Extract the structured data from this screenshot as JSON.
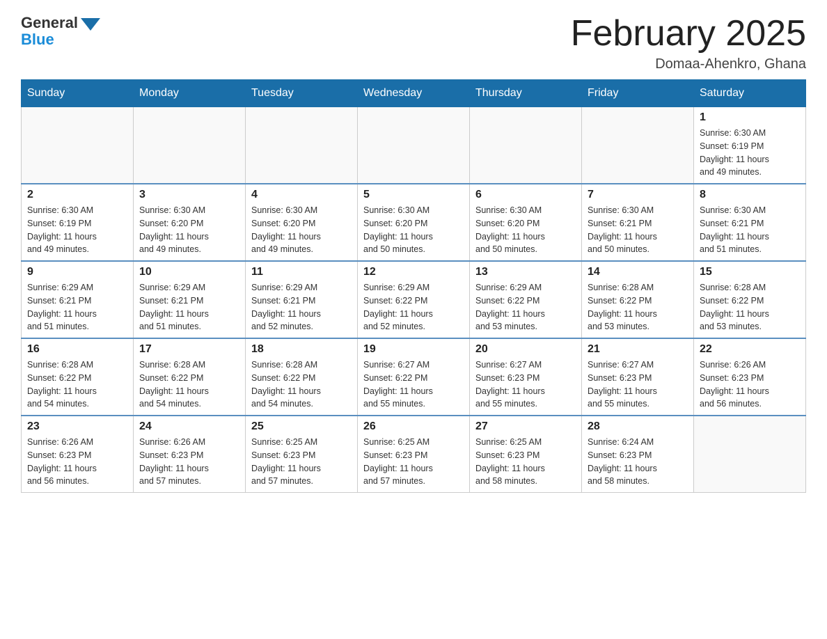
{
  "logo": {
    "general": "General",
    "blue": "Blue"
  },
  "title": "February 2025",
  "location": "Domaa-Ahenkro, Ghana",
  "days_header": [
    "Sunday",
    "Monday",
    "Tuesday",
    "Wednesday",
    "Thursday",
    "Friday",
    "Saturday"
  ],
  "weeks": [
    [
      {
        "day": "",
        "info": ""
      },
      {
        "day": "",
        "info": ""
      },
      {
        "day": "",
        "info": ""
      },
      {
        "day": "",
        "info": ""
      },
      {
        "day": "",
        "info": ""
      },
      {
        "day": "",
        "info": ""
      },
      {
        "day": "1",
        "info": "Sunrise: 6:30 AM\nSunset: 6:19 PM\nDaylight: 11 hours\nand 49 minutes."
      }
    ],
    [
      {
        "day": "2",
        "info": "Sunrise: 6:30 AM\nSunset: 6:19 PM\nDaylight: 11 hours\nand 49 minutes."
      },
      {
        "day": "3",
        "info": "Sunrise: 6:30 AM\nSunset: 6:20 PM\nDaylight: 11 hours\nand 49 minutes."
      },
      {
        "day": "4",
        "info": "Sunrise: 6:30 AM\nSunset: 6:20 PM\nDaylight: 11 hours\nand 49 minutes."
      },
      {
        "day": "5",
        "info": "Sunrise: 6:30 AM\nSunset: 6:20 PM\nDaylight: 11 hours\nand 50 minutes."
      },
      {
        "day": "6",
        "info": "Sunrise: 6:30 AM\nSunset: 6:20 PM\nDaylight: 11 hours\nand 50 minutes."
      },
      {
        "day": "7",
        "info": "Sunrise: 6:30 AM\nSunset: 6:21 PM\nDaylight: 11 hours\nand 50 minutes."
      },
      {
        "day": "8",
        "info": "Sunrise: 6:30 AM\nSunset: 6:21 PM\nDaylight: 11 hours\nand 51 minutes."
      }
    ],
    [
      {
        "day": "9",
        "info": "Sunrise: 6:29 AM\nSunset: 6:21 PM\nDaylight: 11 hours\nand 51 minutes."
      },
      {
        "day": "10",
        "info": "Sunrise: 6:29 AM\nSunset: 6:21 PM\nDaylight: 11 hours\nand 51 minutes."
      },
      {
        "day": "11",
        "info": "Sunrise: 6:29 AM\nSunset: 6:21 PM\nDaylight: 11 hours\nand 52 minutes."
      },
      {
        "day": "12",
        "info": "Sunrise: 6:29 AM\nSunset: 6:22 PM\nDaylight: 11 hours\nand 52 minutes."
      },
      {
        "day": "13",
        "info": "Sunrise: 6:29 AM\nSunset: 6:22 PM\nDaylight: 11 hours\nand 53 minutes."
      },
      {
        "day": "14",
        "info": "Sunrise: 6:28 AM\nSunset: 6:22 PM\nDaylight: 11 hours\nand 53 minutes."
      },
      {
        "day": "15",
        "info": "Sunrise: 6:28 AM\nSunset: 6:22 PM\nDaylight: 11 hours\nand 53 minutes."
      }
    ],
    [
      {
        "day": "16",
        "info": "Sunrise: 6:28 AM\nSunset: 6:22 PM\nDaylight: 11 hours\nand 54 minutes."
      },
      {
        "day": "17",
        "info": "Sunrise: 6:28 AM\nSunset: 6:22 PM\nDaylight: 11 hours\nand 54 minutes."
      },
      {
        "day": "18",
        "info": "Sunrise: 6:28 AM\nSunset: 6:22 PM\nDaylight: 11 hours\nand 54 minutes."
      },
      {
        "day": "19",
        "info": "Sunrise: 6:27 AM\nSunset: 6:22 PM\nDaylight: 11 hours\nand 55 minutes."
      },
      {
        "day": "20",
        "info": "Sunrise: 6:27 AM\nSunset: 6:23 PM\nDaylight: 11 hours\nand 55 minutes."
      },
      {
        "day": "21",
        "info": "Sunrise: 6:27 AM\nSunset: 6:23 PM\nDaylight: 11 hours\nand 55 minutes."
      },
      {
        "day": "22",
        "info": "Sunrise: 6:26 AM\nSunset: 6:23 PM\nDaylight: 11 hours\nand 56 minutes."
      }
    ],
    [
      {
        "day": "23",
        "info": "Sunrise: 6:26 AM\nSunset: 6:23 PM\nDaylight: 11 hours\nand 56 minutes."
      },
      {
        "day": "24",
        "info": "Sunrise: 6:26 AM\nSunset: 6:23 PM\nDaylight: 11 hours\nand 57 minutes."
      },
      {
        "day": "25",
        "info": "Sunrise: 6:25 AM\nSunset: 6:23 PM\nDaylight: 11 hours\nand 57 minutes."
      },
      {
        "day": "26",
        "info": "Sunrise: 6:25 AM\nSunset: 6:23 PM\nDaylight: 11 hours\nand 57 minutes."
      },
      {
        "day": "27",
        "info": "Sunrise: 6:25 AM\nSunset: 6:23 PM\nDaylight: 11 hours\nand 58 minutes."
      },
      {
        "day": "28",
        "info": "Sunrise: 6:24 AM\nSunset: 6:23 PM\nDaylight: 11 hours\nand 58 minutes."
      },
      {
        "day": "",
        "info": ""
      }
    ]
  ]
}
